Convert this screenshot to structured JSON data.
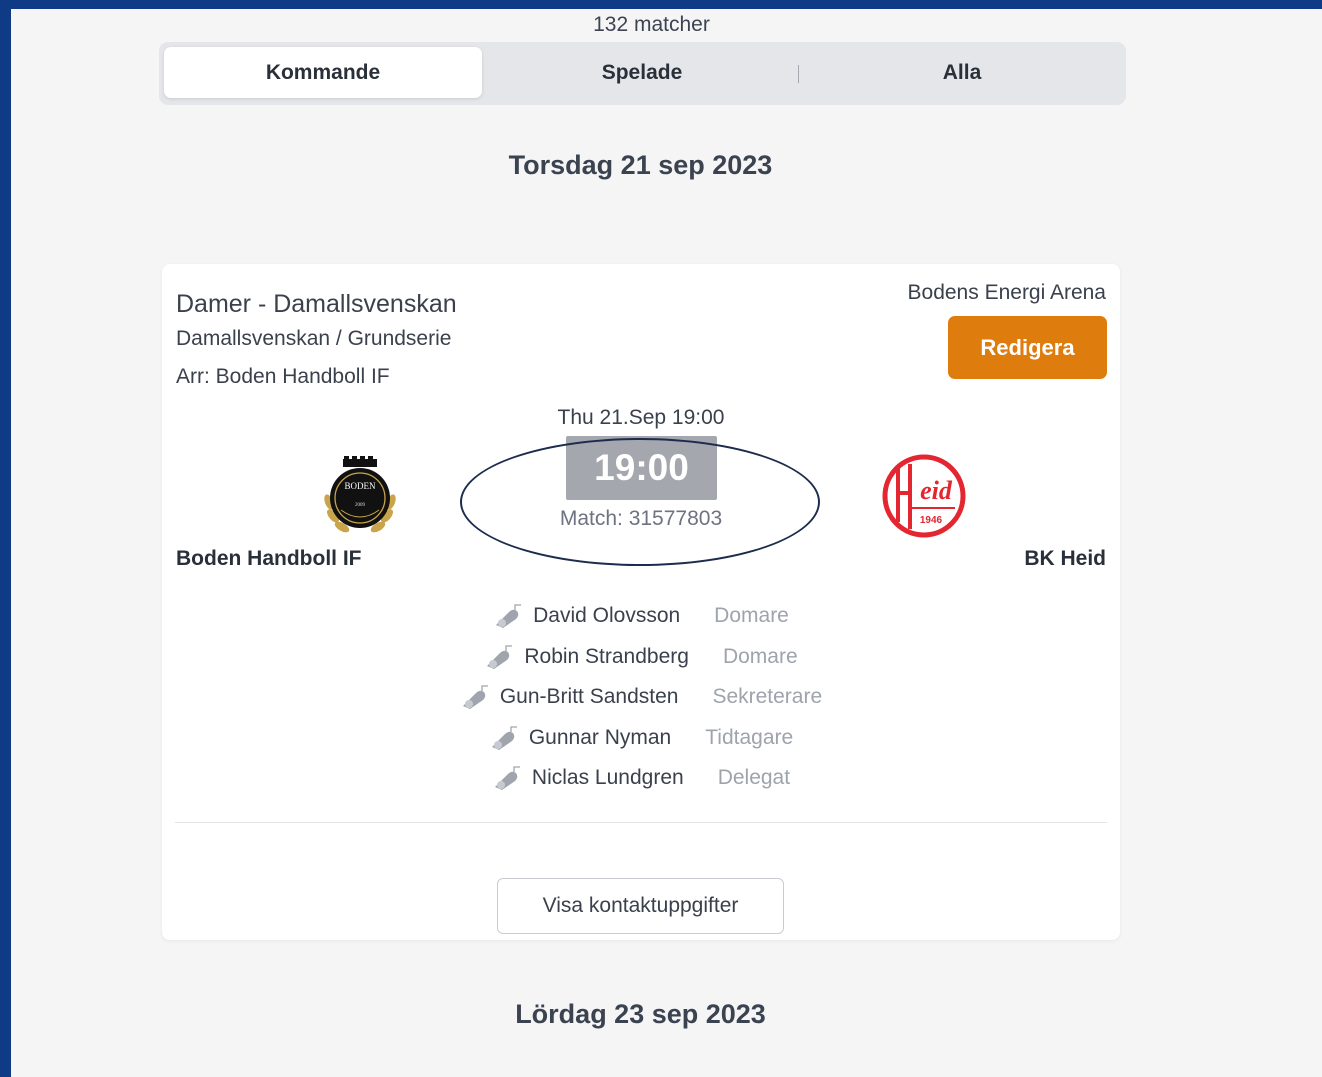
{
  "summary": {
    "match_count": "132 matcher"
  },
  "tabs": [
    {
      "label": "Kommande",
      "active": true
    },
    {
      "label": "Spelade",
      "active": false
    },
    {
      "label": "Alla",
      "active": false
    }
  ],
  "date_headings": [
    "Torsdag 21 sep 2023",
    "Lördag 23 sep 2023"
  ],
  "match": {
    "league": "Damer - Damallsvenskan",
    "series": "Damallsvenskan / Grundserie",
    "organizer": "Arr: Boden Handboll IF",
    "venue": "Bodens Energi Arena",
    "edit_label": "Redigera",
    "datetime": "Thu 21.Sep 19:00",
    "time": "19:00",
    "match_id": "Match: 31577803",
    "home_team": "Boden Handboll IF",
    "away_team": "BK Heid",
    "home_logo": {
      "text_top": "BODEN",
      "text_year": "2009"
    },
    "away_logo": {
      "text": "Heid",
      "year": "1946"
    },
    "officials": [
      {
        "name": "David Olovsson",
        "role": "Domare",
        "icon": "whistle-icon"
      },
      {
        "name": "Robin Strandberg",
        "role": "Domare",
        "icon": "whistle-icon"
      },
      {
        "name": "Gun-Britt Sandsten",
        "role": "Sekreterare",
        "icon": "whistle-icon"
      },
      {
        "name": "Gunnar Nyman",
        "role": "Tidtagare",
        "icon": "whistle-icon"
      },
      {
        "name": "Niclas Lundgren",
        "role": "Delegat",
        "icon": "whistle-icon"
      }
    ],
    "contact_label": "Visa kontaktuppgifter"
  },
  "colors": {
    "frame": "#0e3a86",
    "edit_button": "#df7c0e",
    "time_box": "#a4a7ad",
    "heid_red": "#e3262f"
  }
}
